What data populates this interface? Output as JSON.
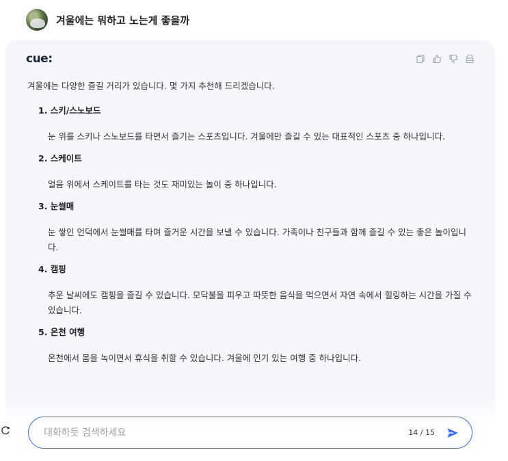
{
  "question": {
    "text": "겨울에는 뭐하고 노는게 좋을까"
  },
  "answer": {
    "brand": "cue:",
    "intro": "겨울에는 다양한 즐길 거리가 있습니다. 몇 가지 추천해 드리겠습니다.",
    "items": [
      {
        "title": "1. 스키/스노보드",
        "desc": "눈 위를 스키나 스노보드를 타면서 즐기는 스포츠입니다. 겨울에만 즐길 수 있는 대표적인 스포츠 중 하나입니다."
      },
      {
        "title": "2. 스케이트",
        "desc": "얼음 위에서 스케이트를 타는 것도 재미있는 놀이 중 하나입니다."
      },
      {
        "title": "3. 눈썰매",
        "desc": "눈 쌓인 언덕에서 눈썰매를 타며 즐거운 시간을 보낼 수 있습니다. 가족이나 친구들과 함께 즐길 수 있는 좋은 놀이입니다."
      },
      {
        "title": "4. 캠핑",
        "desc": "추운 날씨에도 캠핑을 즐길 수 있습니다. 모닥불을 피우고 따뜻한 음식을 먹으면서 자연 속에서 힐링하는 시간을 가질 수 있습니다."
      },
      {
        "title": "5. 온천 여행",
        "desc": "온천에서 몸을 녹이면서 휴식을 취할 수 있습니다. 겨울에 인기 있는 여행 중 하나입니다."
      }
    ],
    "actions": [
      "copy-icon",
      "thumbs-up-icon",
      "thumbs-down-icon",
      "share-icon"
    ]
  },
  "search": {
    "placeholder": "대화하듯 검색하세요",
    "counter": "14 / 15"
  },
  "colors": {
    "accent": "#3a6ff0",
    "card_bg": "#f4f6fb"
  }
}
